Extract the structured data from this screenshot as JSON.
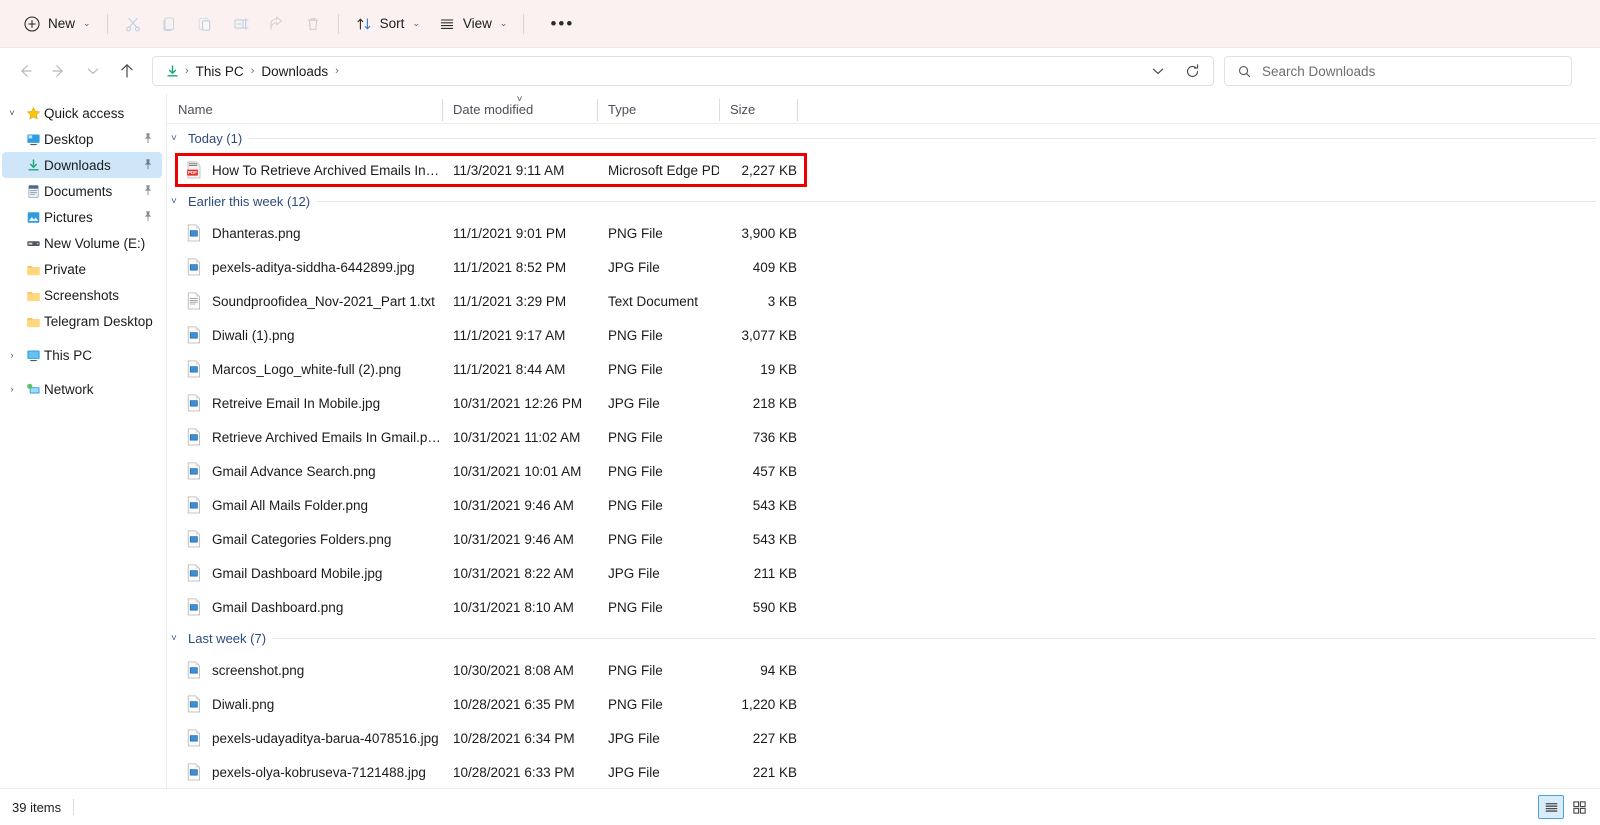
{
  "toolbar": {
    "new_label": "New",
    "sort_label": "Sort",
    "view_label": "View",
    "more_label": "•••",
    "buttons": [
      {
        "name": "cut-button",
        "icon": "scissors-icon",
        "label": ""
      },
      {
        "name": "copy-button",
        "icon": "copy-icon",
        "label": ""
      },
      {
        "name": "paste-button",
        "icon": "paste-icon",
        "label": ""
      },
      {
        "name": "rename-button",
        "icon": "rename-icon",
        "label": ""
      },
      {
        "name": "share-button",
        "icon": "share-icon",
        "label": ""
      },
      {
        "name": "delete-button",
        "icon": "trash-icon",
        "label": ""
      }
    ]
  },
  "nav": {
    "back_icon": "back-arrow-icon",
    "forward_icon": "forward-arrow-icon",
    "recent_icon": "chevron-down-icon",
    "up_icon": "up-arrow-icon",
    "refresh_icon": "refresh-icon",
    "dropdown_icon": "chevron-down-icon",
    "breadcrumbs": [
      "This PC",
      "Downloads"
    ],
    "breadcrumb_leading_icon": "downloads-icon",
    "separator": "›"
  },
  "search": {
    "placeholder": "Search Downloads",
    "icon": "search-icon"
  },
  "sidebar": {
    "items": [
      {
        "label": "Quick access",
        "icon": "star-icon",
        "expander": "˅",
        "depth": 0,
        "pinned": false,
        "selected": false
      },
      {
        "label": "Desktop",
        "icon": "desktop-icon",
        "expander": "",
        "depth": 1,
        "pinned": true,
        "selected": false
      },
      {
        "label": "Downloads",
        "icon": "downloads-icon",
        "expander": "",
        "depth": 1,
        "pinned": true,
        "selected": true
      },
      {
        "label": "Documents",
        "icon": "documents-icon",
        "expander": "",
        "depth": 1,
        "pinned": true,
        "selected": false
      },
      {
        "label": "Pictures",
        "icon": "pictures-icon",
        "expander": "",
        "depth": 1,
        "pinned": true,
        "selected": false
      },
      {
        "label": "New Volume (E:)",
        "icon": "drive-icon",
        "expander": "",
        "depth": 1,
        "pinned": false,
        "selected": false
      },
      {
        "label": "Private",
        "icon": "folder-icon",
        "expander": "",
        "depth": 1,
        "pinned": false,
        "selected": false
      },
      {
        "label": "Screenshots",
        "icon": "folder-icon",
        "expander": "",
        "depth": 1,
        "pinned": false,
        "selected": false
      },
      {
        "label": "Telegram Desktop",
        "icon": "folder-icon",
        "expander": "",
        "depth": 1,
        "pinned": false,
        "selected": false
      },
      {
        "label": "This PC",
        "icon": "pc-icon",
        "expander": "›",
        "depth": 0,
        "pinned": false,
        "selected": false
      },
      {
        "label": "Network",
        "icon": "network-icon",
        "expander": "›",
        "depth": 0,
        "pinned": false,
        "selected": false
      }
    ],
    "pin_icon": "pin-icon"
  },
  "columns": {
    "name": "Name",
    "date_modified": "Date modified",
    "type": "Type",
    "size": "Size",
    "sorted_by": "Date modified",
    "sort_indicator": "˅"
  },
  "groups": [
    {
      "label": "Today (1)",
      "chevron": "˅",
      "rows": [
        {
          "name": "How To Retrieve Archived Emails In Gmai…",
          "date": "11/3/2021 9:11 AM",
          "type": "Microsoft Edge PD…",
          "size": "2,227 KB",
          "icon": "pdf-file-icon",
          "annotated": true
        }
      ]
    },
    {
      "label": "Earlier this week (12)",
      "chevron": "˅",
      "rows": [
        {
          "name": "Dhanteras.png",
          "date": "11/1/2021 9:01 PM",
          "type": "PNG File",
          "size": "3,900 KB",
          "icon": "image-file-icon",
          "annotated": false
        },
        {
          "name": "pexels-aditya-siddha-6442899.jpg",
          "date": "11/1/2021 8:52 PM",
          "type": "JPG File",
          "size": "409 KB",
          "icon": "image-file-icon",
          "annotated": false
        },
        {
          "name": "Soundproofidea_Nov-2021_Part 1.txt",
          "date": "11/1/2021 3:29 PM",
          "type": "Text Document",
          "size": "3 KB",
          "icon": "text-file-icon",
          "annotated": false
        },
        {
          "name": "Diwali (1).png",
          "date": "11/1/2021 9:17 AM",
          "type": "PNG File",
          "size": "3,077 KB",
          "icon": "image-file-icon",
          "annotated": false
        },
        {
          "name": "Marcos_Logo_white-full (2).png",
          "date": "11/1/2021 8:44 AM",
          "type": "PNG File",
          "size": "19 KB",
          "icon": "image-file-icon",
          "annotated": false
        },
        {
          "name": "Retreive Email In Mobile.jpg",
          "date": "10/31/2021 12:26 PM",
          "type": "JPG File",
          "size": "218 KB",
          "icon": "image-file-icon",
          "annotated": false
        },
        {
          "name": "Retrieve Archived Emails In Gmail.png",
          "date": "10/31/2021 11:02 AM",
          "type": "PNG File",
          "size": "736 KB",
          "icon": "image-file-icon",
          "annotated": false
        },
        {
          "name": "Gmail Advance Search.png",
          "date": "10/31/2021 10:01 AM",
          "type": "PNG File",
          "size": "457 KB",
          "icon": "image-file-icon",
          "annotated": false
        },
        {
          "name": "Gmail All Mails Folder.png",
          "date": "10/31/2021 9:46 AM",
          "type": "PNG File",
          "size": "543 KB",
          "icon": "image-file-icon",
          "annotated": false
        },
        {
          "name": "Gmail Categories Folders.png",
          "date": "10/31/2021 9:46 AM",
          "type": "PNG File",
          "size": "543 KB",
          "icon": "image-file-icon",
          "annotated": false
        },
        {
          "name": "Gmail Dashboard Mobile.jpg",
          "date": "10/31/2021 8:22 AM",
          "type": "JPG File",
          "size": "211 KB",
          "icon": "image-file-icon",
          "annotated": false
        },
        {
          "name": "Gmail Dashboard.png",
          "date": "10/31/2021 8:10 AM",
          "type": "PNG File",
          "size": "590 KB",
          "icon": "image-file-icon",
          "annotated": false
        }
      ]
    },
    {
      "label": "Last week (7)",
      "chevron": "˅",
      "rows": [
        {
          "name": "screenshot.png",
          "date": "10/30/2021 8:08 AM",
          "type": "PNG File",
          "size": "94 KB",
          "icon": "image-file-icon",
          "annotated": false
        },
        {
          "name": "Diwali.png",
          "date": "10/28/2021 6:35 PM",
          "type": "PNG File",
          "size": "1,220 KB",
          "icon": "image-file-icon",
          "annotated": false
        },
        {
          "name": "pexels-udayaditya-barua-4078516.jpg",
          "date": "10/28/2021 6:34 PM",
          "type": "JPG File",
          "size": "227 KB",
          "icon": "image-file-icon",
          "annotated": false
        },
        {
          "name": "pexels-olya-kobruseva-7121488.jpg",
          "date": "10/28/2021 6:33 PM",
          "type": "JPG File",
          "size": "221 KB",
          "icon": "image-file-icon",
          "annotated": false
        }
      ]
    }
  ],
  "status": {
    "item_count": "39 items",
    "details_view_icon": "details-view-icon",
    "large_icons_view_icon": "large-icons-view-icon"
  },
  "colors": {
    "toolbar_bg": "#fbf1f0",
    "selection_blue": "#cfe6f8",
    "annotation_red": "#ee0000",
    "group_header_blue": "#2c4a7c",
    "downloads_green": "#17a673"
  }
}
